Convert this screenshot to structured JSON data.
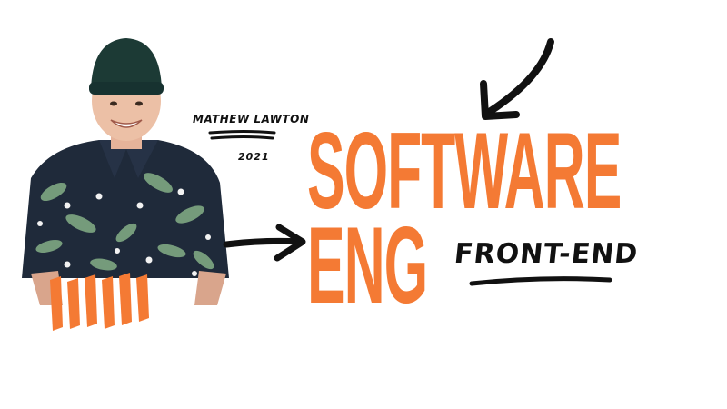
{
  "person": {
    "name": "MATHEW LAWTON",
    "year": "2021"
  },
  "headline": {
    "line1": "SOFTWARE",
    "line2": "ENG",
    "tag": "FRONT-END"
  },
  "colors": {
    "accent": "#F47A34",
    "ink": "#111111"
  },
  "icons": {
    "arrow_down": "curved-arrow-down-icon",
    "arrow_right": "arrow-right-icon",
    "stripes": "orange-brush-stripes"
  }
}
